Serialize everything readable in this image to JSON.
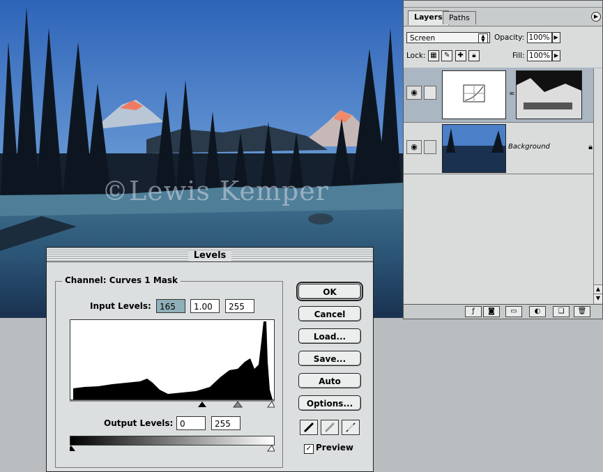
{
  "photo": {
    "watermark": "©Lewis Kemper"
  },
  "layers_panel": {
    "tabs": [
      "Layers",
      "Paths"
    ],
    "blend_mode": "Screen",
    "opacity_label": "Opacity:",
    "opacity_value": "100%",
    "lock_label": "Lock:",
    "fill_label": "Fill:",
    "fill_value": "100%",
    "layers": [
      {
        "name": "",
        "type": "adjustment-curves",
        "selected": true
      },
      {
        "name": "Background",
        "type": "image",
        "selected": false
      }
    ],
    "icons": [
      "eye-icon",
      "mask-icon",
      "link-icon",
      "lock-icon",
      "new-layer-icon",
      "trash-icon",
      "folder-icon",
      "style-icon",
      "adjustment-icon"
    ]
  },
  "levels_dialog": {
    "title": "Levels",
    "channel_label": "Channel: Curves 1 Mask",
    "input_levels_label": "Input Levels:",
    "input_levels": [
      "165",
      "1.00",
      "255"
    ],
    "output_levels_label": "Output Levels:",
    "output_levels": [
      "0",
      "255"
    ],
    "buttons": {
      "ok": "OK",
      "cancel": "Cancel",
      "load": "Load...",
      "save": "Save...",
      "auto": "Auto",
      "options": "Options..."
    },
    "preview_label": "Preview",
    "preview_checked": true
  },
  "colors": {
    "dialog_bg": "#dcdfe0",
    "selected_field": "#8eb0b8",
    "selected_layer": "#aab6c2"
  }
}
